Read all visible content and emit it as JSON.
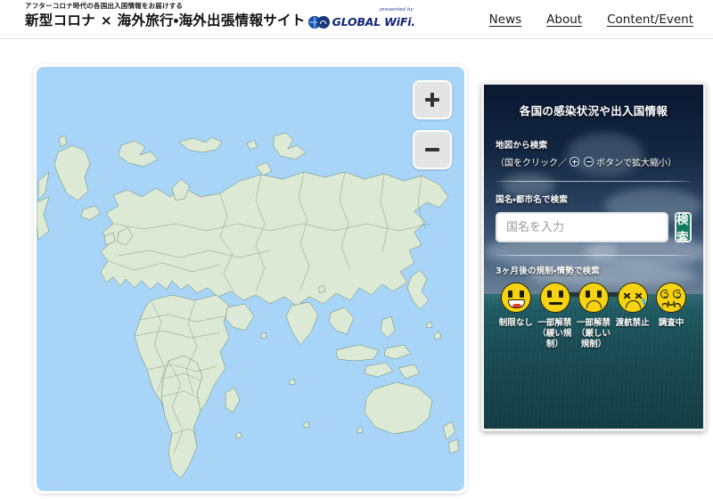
{
  "header": {
    "tagline": "アフターコロナ時代の各国出入国情報をお届けする",
    "title": "新型コロナ × 海外旅行・海外出張情報サイト",
    "logo": {
      "presented_by": "presented by",
      "name": "GLOBAL WiFi."
    },
    "nav": [
      {
        "label": "News"
      },
      {
        "label": "About"
      },
      {
        "label": "Content/Event"
      }
    ]
  },
  "map": {
    "zoom_in_label": "+",
    "zoom_out_label": "−",
    "ocean_color": "#a8d5f7",
    "land_color": "#dce9d4",
    "border_color": "#5a7a5d"
  },
  "panel": {
    "title": "各国の感染状況や出入国情報",
    "map_search": {
      "label": "地図から検索",
      "hint_prefix": "（国をクリック／",
      "hint_suffix": "ボタンで拡大縮小）"
    },
    "name_search": {
      "label": "国名・都市名で検索",
      "placeholder": "国名を入力",
      "value": "",
      "button_label": "検 索",
      "button_color": "#147a5c"
    },
    "status_search": {
      "label": "3ヶ月後の規制・情勢で検索",
      "items": [
        {
          "icon": "grinning-face",
          "label": "制限なし"
        },
        {
          "icon": "neutral-face",
          "label": "一部解禁（緩い規制）"
        },
        {
          "icon": "frowning-face",
          "label": "一部解禁（厳しい規制）"
        },
        {
          "icon": "tired-face",
          "label": "渡航禁止"
        },
        {
          "icon": "dizzy-face",
          "label": "調査中"
        }
      ]
    }
  }
}
